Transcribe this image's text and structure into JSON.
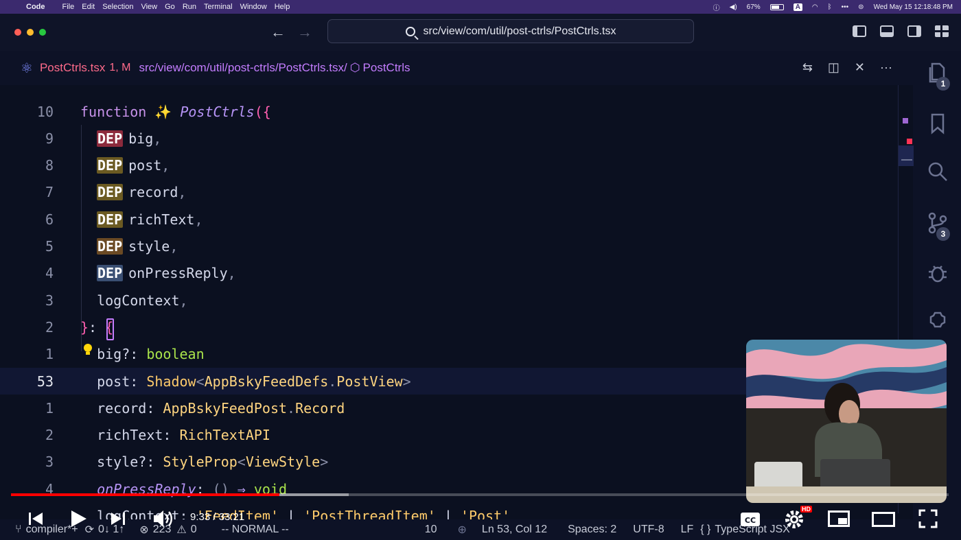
{
  "menubar": {
    "app": "Code",
    "items": [
      "File",
      "Edit",
      "Selection",
      "View",
      "Go",
      "Run",
      "Terminal",
      "Window",
      "Help"
    ],
    "battery": "67%",
    "input_source": "A",
    "datetime": "Wed May 15  12:18:48 PM"
  },
  "command_center": {
    "path": "src/view/com/util/post-ctrls/PostCtrls.tsx"
  },
  "tab": {
    "filename": "PostCtrls.tsx",
    "status": "1, M",
    "breadcrumb_path": "src/view/com/util/post-ctrls/PostCtrls.tsx/",
    "breadcrumb_symbol": "PostCtrls"
  },
  "activity": {
    "explorer_badge": "1",
    "scm_badge": "3"
  },
  "editor": {
    "lines": [
      {
        "num": "10",
        "parts": [
          [
            "kw",
            "function "
          ],
          [
            "plain",
            "✨ "
          ],
          [
            "fn",
            "PostCtrls"
          ],
          [
            "br",
            "({"
          ]
        ]
      },
      {
        "num": "9",
        "dep": "DEP",
        "dep_color": "#8c2a3c",
        "parts": [
          [
            "plain",
            "big"
          ],
          [
            "punc",
            ","
          ]
        ]
      },
      {
        "num": "8",
        "dep": "DEP",
        "dep_color": "#6b5a22",
        "parts": [
          [
            "plain",
            "post"
          ],
          [
            "punc",
            ","
          ]
        ]
      },
      {
        "num": "7",
        "dep": "DEP",
        "dep_color": "#6b5a22",
        "parts": [
          [
            "plain",
            "record"
          ],
          [
            "punc",
            ","
          ]
        ]
      },
      {
        "num": "6",
        "dep": "DEP",
        "dep_color": "#6b5a22",
        "parts": [
          [
            "plain",
            "richText"
          ],
          [
            "punc",
            ","
          ]
        ]
      },
      {
        "num": "5",
        "dep": "DEP",
        "dep_color": "#6b4a24",
        "parts": [
          [
            "plain",
            "style"
          ],
          [
            "punc",
            ","
          ]
        ]
      },
      {
        "num": "4",
        "dep": "DEP",
        "dep_color": "#3a4f73",
        "parts": [
          [
            "plain",
            "onPressReply"
          ],
          [
            "punc",
            ","
          ]
        ]
      },
      {
        "num": "3",
        "parts": [
          [
            "plain",
            "  logContext"
          ],
          [
            "punc",
            ","
          ]
        ]
      },
      {
        "num": "2",
        "parts": [
          [
            "br",
            "}"
          ],
          [
            "plain",
            ": "
          ],
          [
            "br",
            "{"
          ]
        ]
      },
      {
        "num": "1",
        "parts": [
          [
            "plain",
            "  big?: "
          ],
          [
            "kw2",
            "boolean"
          ]
        ]
      },
      {
        "num": "53",
        "current": true,
        "parts": [
          [
            "plain",
            "  post: "
          ],
          [
            "ty",
            "Shadow"
          ],
          [
            "punc",
            "<"
          ],
          [
            "ty2",
            "AppBskyFeedDefs"
          ],
          [
            "punc",
            "."
          ],
          [
            "ty2",
            "PostView"
          ],
          [
            "punc",
            ">"
          ]
        ]
      },
      {
        "num": "1",
        "parts": [
          [
            "plain",
            "  record: "
          ],
          [
            "ty2",
            "AppBskyFeedPost"
          ],
          [
            "punc",
            "."
          ],
          [
            "ty2",
            "Record"
          ]
        ]
      },
      {
        "num": "2",
        "parts": [
          [
            "plain",
            "  richText: "
          ],
          [
            "ty2",
            "RichTextAPI"
          ]
        ]
      },
      {
        "num": "3",
        "parts": [
          [
            "plain",
            "  style?: "
          ],
          [
            "ty2",
            "StyleProp"
          ],
          [
            "punc",
            "<"
          ],
          [
            "ty2",
            "ViewStyle"
          ],
          [
            "punc",
            ">"
          ]
        ]
      },
      {
        "num": "4",
        "parts": [
          [
            "ital",
            "  onPressReply"
          ],
          [
            "plain",
            ": "
          ],
          [
            "punc",
            "() "
          ],
          [
            "gen",
            "⇒ "
          ],
          [
            "kw2",
            "void"
          ]
        ]
      },
      {
        "num": "",
        "parts": [
          [
            "plain",
            "  logContext: "
          ],
          [
            "str",
            "'FeedItem'"
          ],
          [
            "plain",
            " | "
          ],
          [
            "str",
            "'PostThreadItem'"
          ],
          [
            "plain",
            " | "
          ],
          [
            "str",
            "'Post'"
          ]
        ]
      }
    ]
  },
  "statusbar": {
    "branch": "compiler*+",
    "sync": "0↓ 1↑",
    "errors": "223",
    "warnings": "0",
    "mode": "-- NORMAL --",
    "count": "10",
    "position": "Ln 53, Col 12",
    "spaces": "Spaces: 2",
    "encoding": "UTF-8",
    "eol": "LF",
    "language": "TypeScript JSX"
  },
  "video": {
    "time": "9:33 / 33:21",
    "played_fraction": 0.286,
    "buffered_fraction": 0.36,
    "quality_badge": "HD"
  },
  "icons": {
    "apple": "apple-icon",
    "search": "search-icon",
    "play": "play-icon",
    "settings": "gear-icon"
  }
}
